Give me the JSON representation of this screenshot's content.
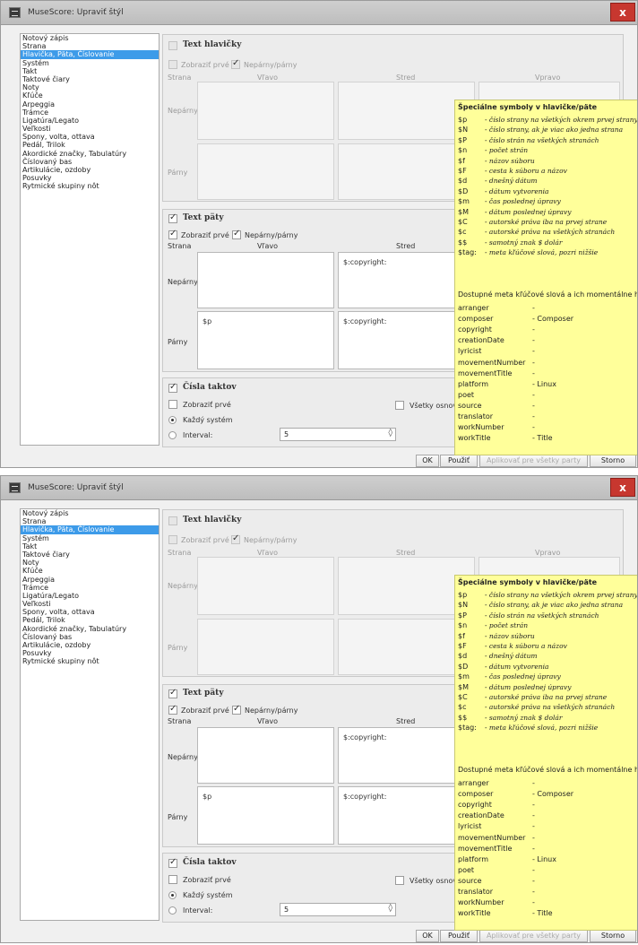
{
  "window_title": "MuseScore: Upraviť štýl",
  "close_label": "x",
  "categories": [
    "Notový zápis",
    "Strana",
    "Hlavička, Päta, Číslovanie",
    "Systém",
    "Takt",
    "Taktové čiary",
    "Noty",
    "Kľúče",
    "Arpeggia",
    "Trámce",
    "Ligatúra/Legato",
    "Veľkosti",
    "Spony, volta, ottava",
    "Pedál, Trilok",
    "Akordické značky, Tabulatúry",
    "Číslovaný bas",
    "Artikulácie, ozdoby",
    "Posuvky",
    "Rytmické skupiny nôt"
  ],
  "selected_category": "Hlavička, Päta, Číslovanie",
  "header": {
    "title": "Text hlavičky",
    "checked": false,
    "show_first": "Zobraziť prvé",
    "odd_even": "Nepárny/párny",
    "col_page": "Strana",
    "col_left": "Vľavo",
    "col_center": "Stred",
    "col_right": "Vpravo",
    "row_odd": "Nepárny",
    "row_even": "Párny"
  },
  "footer": {
    "title": "Text päty",
    "checked": true,
    "show_first": "Zobraziť prvé",
    "odd_even": "Nepárny/párny",
    "col_page": "Strana",
    "col_left": "Vľavo",
    "col_center": "Stred",
    "row_odd": "Nepárny",
    "row_even": "Párny",
    "odd_center": "$:copyright:",
    "even_left": "$p",
    "even_center": "$:copyright:"
  },
  "measure_numbers": {
    "title": "Čísla taktov",
    "checked": true,
    "show_first": "Zobraziť prvé",
    "every_system": "Každý systém",
    "interval": "Interval:",
    "interval_value": "5",
    "all_staves": "Všetky osnov"
  },
  "buttons": {
    "ok": "OK",
    "apply": "Použiť",
    "apply_parts": "Aplikovať pre všetky party",
    "cancel": "Storno"
  },
  "tooltip": {
    "title": "Špeciálne symboly v hlavičke/päte",
    "symbols": [
      {
        "sym": "$p",
        "desc": "- číslo strany na všetkých okrem prvej strany"
      },
      {
        "sym": "$N",
        "desc": "- číslo strany, ak je viac ako jedna strana"
      },
      {
        "sym": "$P",
        "desc": "- číslo strán na všetkých stranách"
      },
      {
        "sym": "$n",
        "desc": "- počet strán"
      },
      {
        "sym": "$f",
        "desc": "- názov súboru"
      },
      {
        "sym": "$F",
        "desc": "- cesta k súboru a názov"
      },
      {
        "sym": "$d",
        "desc": "- dnešný dátum"
      },
      {
        "sym": "$D",
        "desc": "- dátum vytvorenia"
      },
      {
        "sym": "$m",
        "desc": "- čas poslednej úpravy"
      },
      {
        "sym": "$M",
        "desc": "- dátum poslednej úpravy"
      },
      {
        "sym": "$C",
        "desc": "- autorské práva iba na prvej strane"
      },
      {
        "sym": "$c",
        "desc": "- autorské práva na všetkých stranách"
      },
      {
        "sym": "$$",
        "desc": "- samotný znak $ dolár"
      },
      {
        "sym": "$tag:",
        "desc": "- meta kľúčové slová, pozri nižšie"
      }
    ],
    "meta_intro": "Dostupné meta kľúčové slová a ich momentálne h",
    "meta": [
      {
        "key": "arranger",
        "val": "-"
      },
      {
        "key": "composer",
        "val": "- Composer"
      },
      {
        "key": "copyright",
        "val": "-"
      },
      {
        "key": "creationDate",
        "val": "-"
      },
      {
        "key": "lyricist",
        "val": "-"
      },
      {
        "key": "movementNumber",
        "val": "-"
      },
      {
        "key": "movementTitle",
        "val": "-"
      },
      {
        "key": "platform",
        "val": "- Linux"
      },
      {
        "key": "poet",
        "val": "-"
      },
      {
        "key": "source",
        "val": "-"
      },
      {
        "key": "translator",
        "val": "-"
      },
      {
        "key": "workNumber",
        "val": "-"
      },
      {
        "key": "workTitle",
        "val": "- Title"
      }
    ]
  }
}
